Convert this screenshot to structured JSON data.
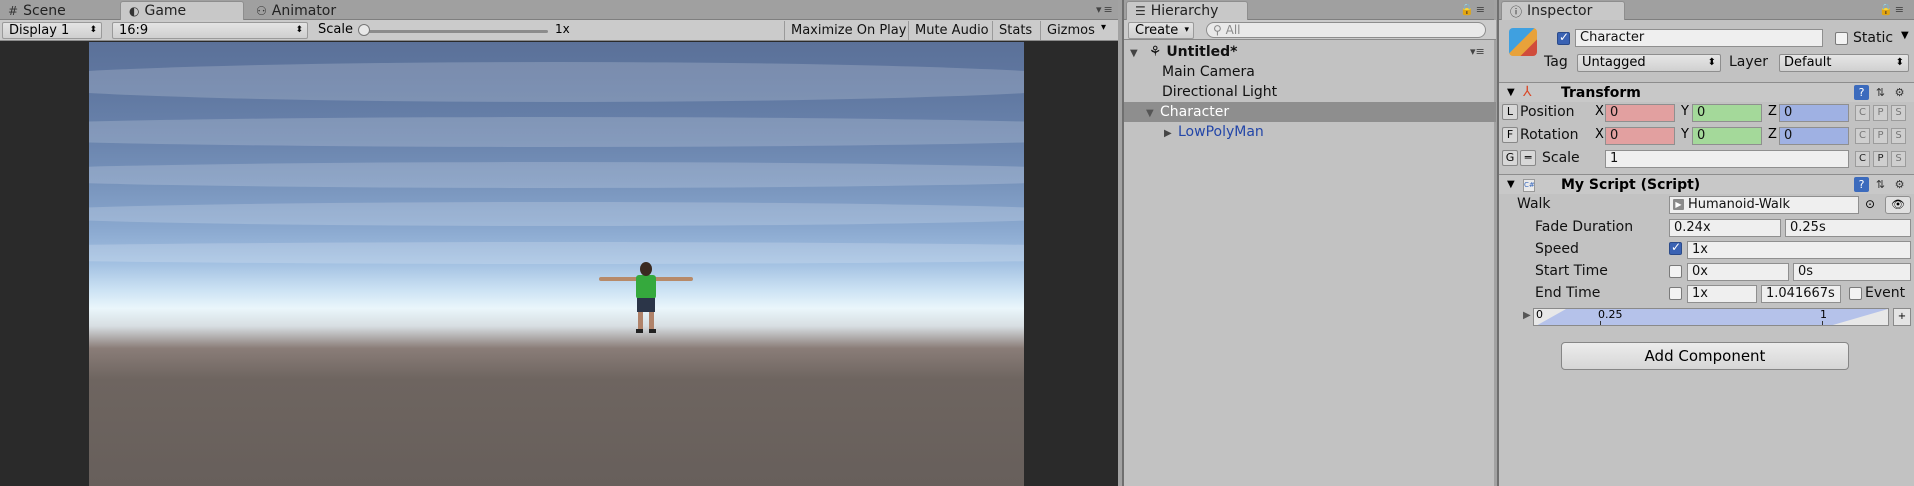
{
  "game_panel": {
    "tabs": [
      {
        "icon": "grid-icon",
        "label": "Scene"
      },
      {
        "icon": "game-controller-icon",
        "label": "Game"
      },
      {
        "icon": "animator-icon",
        "label": "Animator"
      }
    ],
    "toolbar": {
      "display": "Display 1",
      "aspect": "16:9",
      "scale_label": "Scale",
      "scale_value": "1x",
      "maximize_on_play": "Maximize On Play",
      "mute_audio": "Mute Audio",
      "stats": "Stats",
      "gizmos": "Gizmos"
    }
  },
  "hierarchy": {
    "tab_label": "Hierarchy",
    "create_label": "Create",
    "search_placeholder": "All",
    "scene_name": "Untitled*",
    "items": [
      {
        "label": "Main Camera"
      },
      {
        "label": "Directional Light"
      },
      {
        "label": "Character"
      },
      {
        "label": "LowPolyMan"
      }
    ]
  },
  "inspector": {
    "tab_label": "Inspector",
    "object_name": "Character",
    "static_label": "Static",
    "tag_label": "Tag",
    "tag_value": "Untagged",
    "layer_label": "Layer",
    "layer_value": "Default",
    "transform": {
      "title": "Transform",
      "position_label": "Position",
      "rotation_label": "Rotation",
      "scale_label": "Scale",
      "lock_letters": [
        "L",
        "F",
        "G"
      ],
      "axis_x": "X",
      "axis_y": "Y",
      "axis_z": "Z",
      "position": {
        "x": "0",
        "y": "0",
        "z": "0"
      },
      "rotation": {
        "x": "0",
        "y": "0",
        "z": "0"
      },
      "scale": "1",
      "cps": [
        "C",
        "P",
        "S"
      ]
    },
    "script": {
      "title": "My Script (Script)",
      "walk_label": "Walk",
      "walk_value": "Humanoid-Walk",
      "fade_duration_label": "Fade Duration",
      "fade_duration_x": "0.24x",
      "fade_duration_s": "0.25s",
      "speed_label": "Speed",
      "speed_value": "1x",
      "start_time_label": "Start Time",
      "start_time_x": "0x",
      "start_time_s": "0s",
      "end_time_label": "End Time",
      "end_time_x": "1x",
      "end_time_s": "1.041667s",
      "event_label": "Event",
      "timeline_ticks": [
        "0",
        "0.25",
        "1"
      ]
    },
    "add_component": "Add Component"
  },
  "colors": {
    "x_field": "#e2a0a0",
    "y_field": "#a4d99a",
    "z_field": "#9fb1e3",
    "selection": "#8e8e8e",
    "accent_link": "#2346a8"
  }
}
